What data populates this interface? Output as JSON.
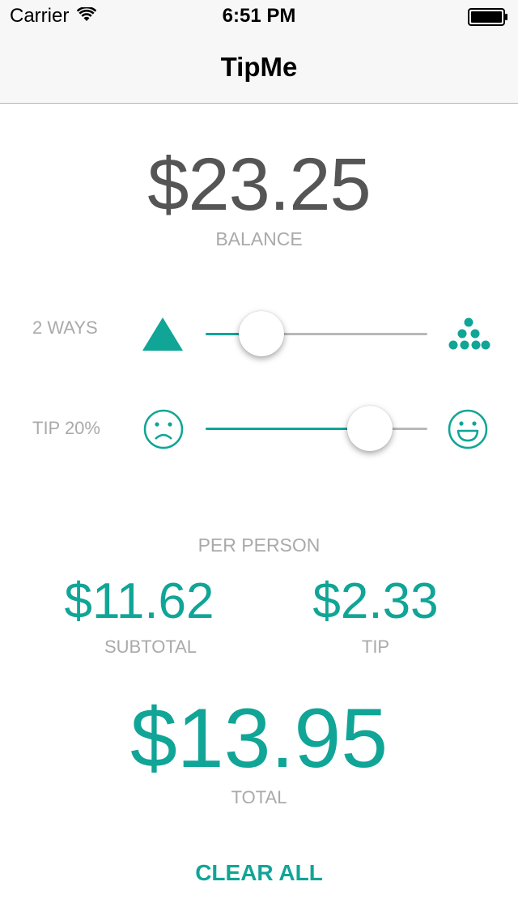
{
  "status_bar": {
    "carrier": "Carrier",
    "time": "6:51 PM",
    "icons": [
      "wifi-icon",
      "battery-icon"
    ]
  },
  "nav": {
    "title": "TipMe"
  },
  "balance": {
    "amount": "$23.25",
    "label": "BALANCE"
  },
  "split": {
    "label": "2 WAYS",
    "slider_value_fraction": 0.25,
    "min_icon": "triangle-icon",
    "max_icon": "dots-pyramid-icon"
  },
  "tip": {
    "label": "TIP 20%",
    "slider_value_fraction": 0.74,
    "min_icon": "sad-face-icon",
    "max_icon": "happy-face-icon"
  },
  "per_person": {
    "heading": "PER PERSON",
    "subtotal_amount": "$11.62",
    "subtotal_label": "SUBTOTAL",
    "tip_amount": "$2.33",
    "tip_label": "TIP",
    "total_amount": "$13.95",
    "total_label": "TOTAL"
  },
  "actions": {
    "clear_all": "CLEAR ALL"
  },
  "colors": {
    "accent": "#10a596",
    "muted_text": "#aaaaaa",
    "balance_text": "#555555"
  }
}
